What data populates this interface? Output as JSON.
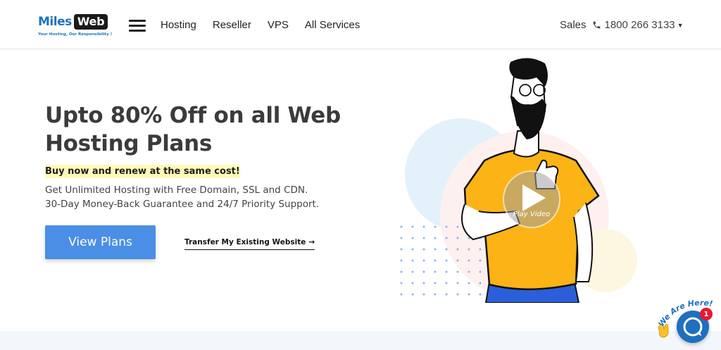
{
  "brand": {
    "name_part1": "Miles",
    "name_part2": "Web",
    "tagline": "Your Hosting, Our Responsibility !",
    "primary_color": "#1e73be",
    "accent_color": "#4a8ee6"
  },
  "nav": {
    "menu_icon": "hamburger-menu-icon",
    "items": [
      {
        "label": "Hosting"
      },
      {
        "label": "Reseller"
      },
      {
        "label": "VPS"
      },
      {
        "label": "All Services"
      }
    ]
  },
  "sales": {
    "label": "Sales",
    "phone_icon": "phone-icon",
    "phone": "1800 266 3133",
    "caret_icon": "caret-down-icon"
  },
  "hero": {
    "headline": "Upto 80% Off on all Web Hosting Plans",
    "highlight": "Buy now and renew at the same cost!",
    "description_line1": "Get Unlimited Hosting with Free Domain, SSL and CDN.",
    "description_line2": "30-Day Money-Back Guarantee and 24/7 Priority Support.",
    "primary_button": "View Plans",
    "secondary_link": "Transfer My Existing Website",
    "secondary_link_icon": "arrow-right-icon",
    "highlight_color": "#fff9b8"
  },
  "video": {
    "play_icon": "play-icon",
    "label": "Play Video"
  },
  "chat": {
    "label": "We Are Here!",
    "wave_icon": "waving-hand-icon",
    "chat_icon": "chat-bubble-icon",
    "badge_count": "1",
    "badge_color": "#e8192c"
  }
}
